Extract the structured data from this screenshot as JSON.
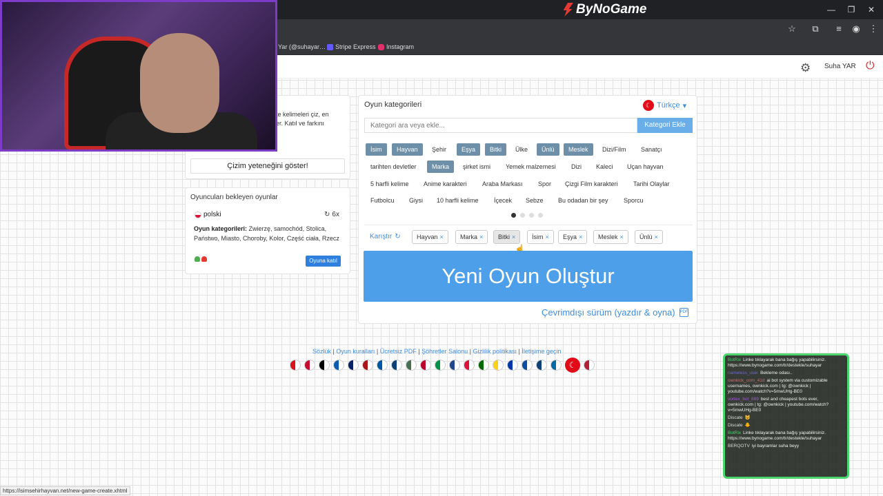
{
  "browser": {
    "brand": "ByNoGame",
    "bookmarks": [
      {
        "label": "Yar (@suhayar…",
        "color": "#5a5a5a"
      },
      {
        "label": "Stripe Express",
        "color": "#635bff"
      },
      {
        "label": "Instagram",
        "color": "#e1306c"
      }
    ],
    "status_url": "https://isimsehirhayvan.net/new-game-create.xhtml"
  },
  "header": {
    "user_name": "Suha YAR"
  },
  "intro": {
    "text_line1": "te kelimeleri çiz, en",
    "text_line2": "er. Katıl ve farkını",
    "show_drawing_button": "Çizim yeteneğini göster!"
  },
  "waiting_games": {
    "title": "Oyuncuları bekleyen oyunlar",
    "items": [
      {
        "language": "polski",
        "multiplier": "6x",
        "categories_label": "Oyun kategorileri:",
        "categories": "Zwierzę, samochód, Stolica, Państwo, Miasto, Choroby, Kolor, Część ciała, Rzecz",
        "join_label": "Oyuna katıl"
      }
    ]
  },
  "categories_panel": {
    "title": "Oyun kategorileri",
    "language": "Türkçe",
    "search_placeholder": "Kategori ara veya ekle...",
    "add_button": "Kategori Ekle",
    "chips": [
      {
        "label": "İsim",
        "selected": true
      },
      {
        "label": "Hayvan",
        "selected": true
      },
      {
        "label": "Şehir",
        "selected": false
      },
      {
        "label": "Eşya",
        "selected": true
      },
      {
        "label": "Bitki",
        "selected": true
      },
      {
        "label": "Ülke",
        "selected": false
      },
      {
        "label": "Ünlü",
        "selected": true
      },
      {
        "label": "Meslek",
        "selected": true
      },
      {
        "label": "Dizi/Film",
        "selected": false
      },
      {
        "label": "Sanatçı",
        "selected": false
      },
      {
        "label": "tarihten devletler",
        "selected": false
      },
      {
        "label": "Marka",
        "selected": true
      },
      {
        "label": "şirket ismi",
        "selected": false
      },
      {
        "label": "Yemek malzemesi",
        "selected": false
      },
      {
        "label": "Dizi",
        "selected": false
      },
      {
        "label": "Kaleci",
        "selected": false
      },
      {
        "label": "Uçan hayvan",
        "selected": false
      },
      {
        "label": "5 harfli kelime",
        "selected": false
      },
      {
        "label": "Anime karakteri",
        "selected": false
      },
      {
        "label": "Araba Markası",
        "selected": false
      },
      {
        "label": "Spor",
        "selected": false
      },
      {
        "label": "Çizgi Film karakteri",
        "selected": false
      },
      {
        "label": "Tarihi Olaylar",
        "selected": false
      },
      {
        "label": "Futbolcu",
        "selected": false
      },
      {
        "label": "Giysi",
        "selected": false
      },
      {
        "label": "10 harfli kelime",
        "selected": false
      },
      {
        "label": "İçecek",
        "selected": false
      },
      {
        "label": "Sebze",
        "selected": false
      },
      {
        "label": "Bu odadan bir şey",
        "selected": false
      },
      {
        "label": "Sporcu",
        "selected": false
      }
    ],
    "carousel_pages": 4,
    "carousel_active": 1,
    "shuffle_label": "Karıştır",
    "selected_tags": [
      "Hayvan",
      "Marka",
      "Bitki",
      "İsim",
      "Eşya",
      "Meslek",
      "Ünlü"
    ],
    "create_button": "Yeni Oyun Oluştur",
    "offline_link": "Çevrimdışı sürüm (yazdır & oyna)"
  },
  "footer": {
    "links": [
      "Sözlük",
      "Oyun kuralları",
      "Ücretsiz PDF",
      "Şöhretler Salonu",
      "Gizlilik politikası",
      "İletişime geçin"
    ],
    "flag_colors": [
      "#d7141a",
      "#c60c30",
      "#000000",
      "#0d5eaf",
      "#012169",
      "#aa151b",
      "#0055a4",
      "#0c4076",
      "#477050",
      "#bc002d",
      "#009246",
      "#21468b",
      "#dc143c",
      "#006600",
      "#fcd116",
      "#0039a6",
      "#0b4ea2",
      "#0c4076",
      "#006aa7",
      "#e30a17",
      "#b22234"
    ]
  },
  "chat": {
    "messages": [
      {
        "name": "BotRix",
        "color": "#4ad66d",
        "text": "Linke tıklayarak bana bağış yapabilirsiniz. https://www.bynogame.com/tr/destekle/suhayar"
      },
      {
        "name": "nameless_user",
        "color": "#6a6ad6",
        "text": "Bekleme odası.."
      },
      {
        "name": "ownkick_com_41d",
        "color": "#d66a6a",
        "text": "ai bot system via customizable usernames, ownkick.com | tg: @ownkick | youtube.com/watch?v=5mwUHg-BE0"
      },
      {
        "name": "vortex_bot_889",
        "color": "#a05ad6",
        "text": "best and cheapest bots ever, ownkick.com | tg: @ownkick | youtube.com/watch?v=5mwUHg-BE0"
      },
      {
        "name": "Discate",
        "color": "#dddddd",
        "text": "🐱"
      },
      {
        "name": "Discate",
        "color": "#dddddd",
        "text": "🐥"
      },
      {
        "name": "BotRix",
        "color": "#4ad66d",
        "text": "Linke tıklayarak bana bağış yapabilirsiniz. https://www.bynogame.com/tr/destekle/suhayar"
      },
      {
        "name": "BERQOTV",
        "color": "#dddddd",
        "text": "iyi bayramlar suha beyy"
      }
    ]
  }
}
